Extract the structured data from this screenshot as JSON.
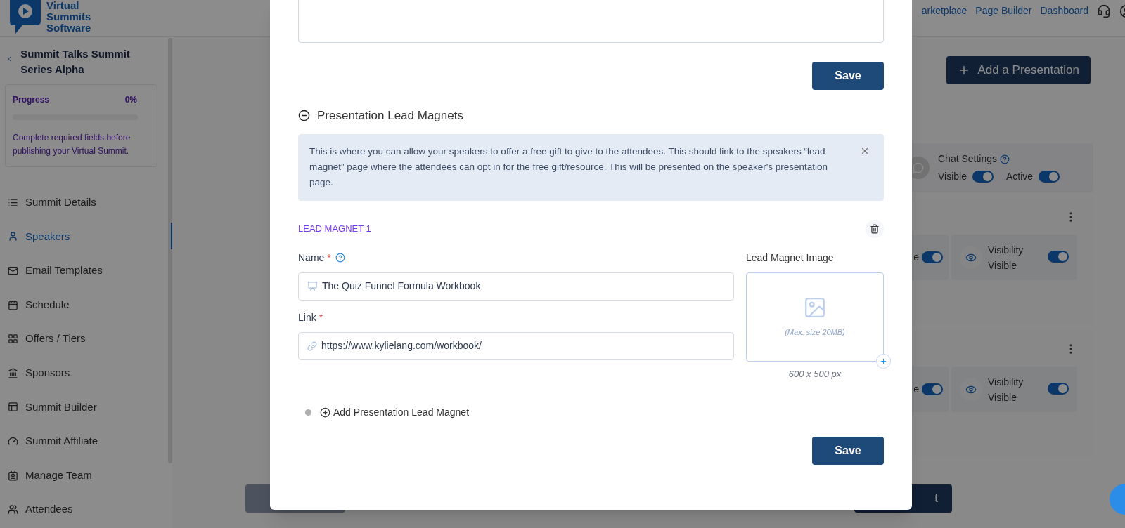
{
  "header": {
    "logo_text": [
      "Virtual",
      "Summits",
      "Software"
    ],
    "nav_links": [
      "arketplace",
      "Page Builder",
      "Dashboard"
    ]
  },
  "sidebar": {
    "title": "Summit Talks Summit Series Alpha",
    "progress": {
      "label": "Progress",
      "reading": "0%",
      "level": 0,
      "note": "Complete required fields before publishing your Virtual Summit."
    },
    "items": [
      {
        "label": "Summit Details",
        "selected": false
      },
      {
        "label": "Speakers",
        "selected": true
      },
      {
        "label": "Email Templates",
        "selected": false
      },
      {
        "label": "Schedule",
        "selected": false
      },
      {
        "label": "Offers / Tiers",
        "selected": false
      },
      {
        "label": "Sponsors",
        "selected": false
      },
      {
        "label": "Summit Builder",
        "selected": false
      },
      {
        "label": "Summit Affiliate",
        "selected": false
      },
      {
        "label": "Manage Team",
        "selected": false
      },
      {
        "label": "Attendees",
        "selected": false
      }
    ]
  },
  "main": {
    "add_button": "Add a Presentation",
    "chat_settings": {
      "title": "Chat Settings",
      "toggles": [
        {
          "label": "Visible",
          "on": true
        },
        {
          "label": "Active",
          "on": true
        }
      ]
    },
    "speaker_cards": [
      {
        "cut_label": "e",
        "cut_on": true,
        "visibility_title": "Visibility",
        "visibility_value": "Visible",
        "visibility_on": true
      },
      {
        "cut_label": "e",
        "cut_on": true,
        "visibility_title": "Visibility",
        "visibility_value": "Visible",
        "visibility_on": true
      }
    ],
    "footer_button": "t"
  },
  "modal": {
    "save_top": "Save",
    "section": {
      "title": "Presentation Lead Magnets",
      "expanded": true
    },
    "info": "This is where you can allow your speakers to offer a free gift to give to the attendees. This should link to the speakers “lead magnet” page where the attendees can opt in for the free gift/resource. This will be presented on the speaker's presentation page.",
    "lead_magnets": [
      {
        "title": "LEAD MAGNET 1",
        "fields": [
          {
            "kind": "name",
            "label": "Name",
            "mark": "*",
            "help": true,
            "value": "The Quiz Funnel Formula Workbook"
          },
          {
            "kind": "link",
            "label": "Link",
            "mark": "*",
            "help": false,
            "value": "https://www.kylielang.com/workbook/"
          }
        ],
        "image": {
          "label": "Lead Magnet Image",
          "hint": "(Max. size 20MB)",
          "size": "600 x 500 px"
        }
      }
    ],
    "add_button": "Add Presentation Lead Magnet",
    "save_bottom": "Save"
  }
}
